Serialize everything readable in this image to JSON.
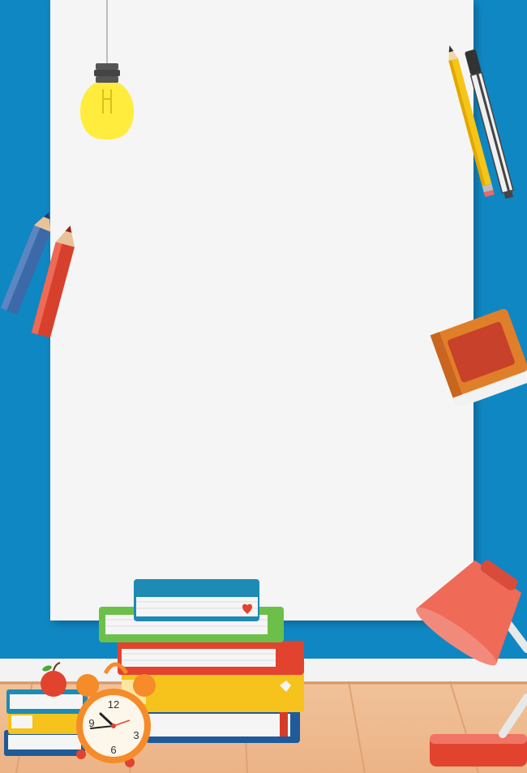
{
  "colors": {
    "wall_blue": "#0f87c3",
    "wall_blue_dark": "#0b6fa2",
    "board_white": "#f5f5f5",
    "floor_wood": "#f2c49b",
    "floor_line": "#e0a97c",
    "baseboard": "#f4f4f4"
  },
  "clock": {
    "numbers": [
      "12",
      "3",
      "6",
      "9"
    ]
  },
  "icons": [
    "light-bulb-icon",
    "pen-and-pencil-icon",
    "colored-pencils-icon",
    "closed-book-icon",
    "book-stack-icon",
    "apple-icon",
    "alarm-clock-icon",
    "desk-lamp-icon"
  ]
}
